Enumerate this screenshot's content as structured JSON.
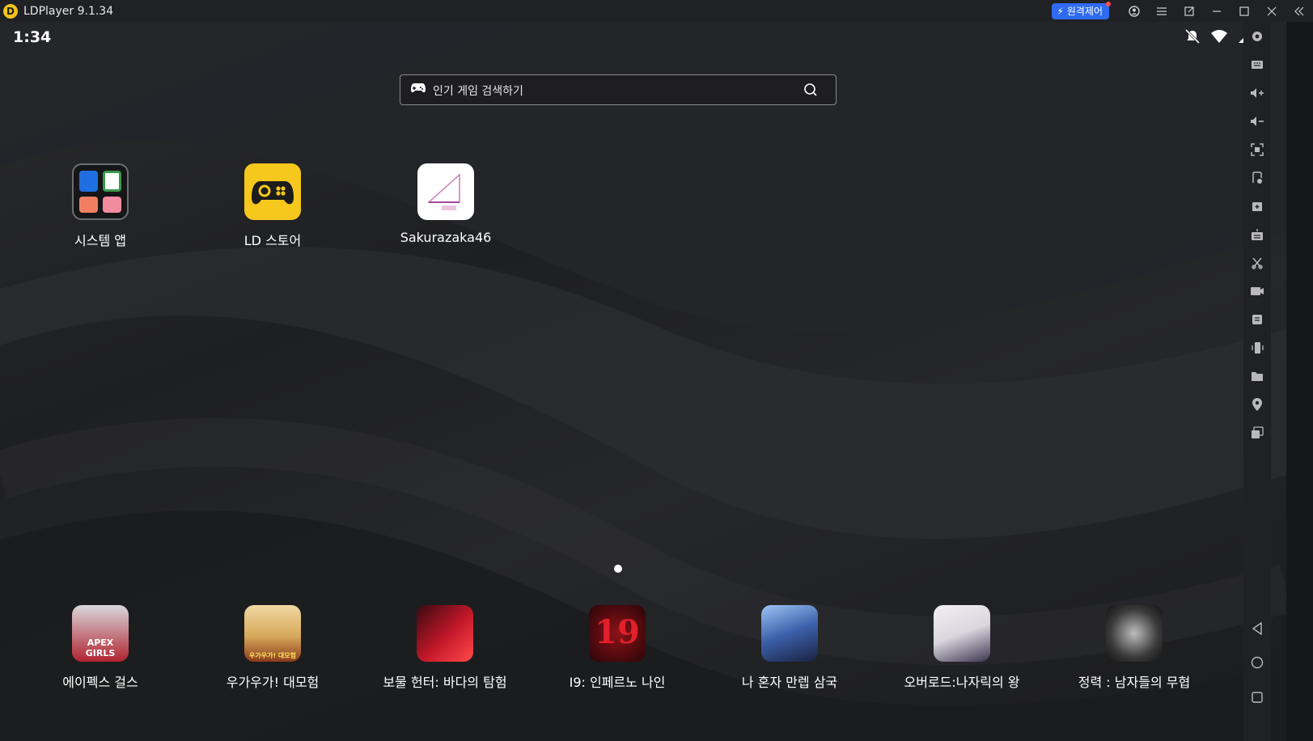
{
  "window": {
    "title": "LDPlayer 9.1.34",
    "remote_button": "원격제어"
  },
  "statusbar": {
    "time": "1:34"
  },
  "search": {
    "placeholder": "인기 게임 검색하기"
  },
  "apps": [
    {
      "label": "시스템 앱",
      "icon": "folder-icon"
    },
    {
      "label": "LD 스토어",
      "icon": "gamepad-icon",
      "color": "#f6c71c"
    },
    {
      "label": "Sakurazaka46",
      "icon": "sakurazaka-icon",
      "color": "#ffffff"
    }
  ],
  "dock": [
    {
      "label": "에이펙스 걸스",
      "icon_text": "APEX GIRLS",
      "color": "#b0232f"
    },
    {
      "label": "우가우가! 대모험",
      "icon_text": "우가우가! 대모험",
      "color": "#d7a95a"
    },
    {
      "label": "보물 헌터: 바다의 탐험",
      "color": "#c4182a"
    },
    {
      "label": "I9: 인페르노 나인",
      "icon_text": "19",
      "color": "#5e0a0f"
    },
    {
      "label": "나 혼자 만렙 삼국",
      "color": "#3b5fa8"
    },
    {
      "label": "오버로드:나자릭의 왕",
      "color": "#d9d6de"
    },
    {
      "label": "정력 : 남자들의 무협",
      "color": "#3a3a3a"
    }
  ],
  "colors": {
    "titlebar": "#202124",
    "accent": "#2f6bf0",
    "ld_yellow": "#f2c318"
  }
}
